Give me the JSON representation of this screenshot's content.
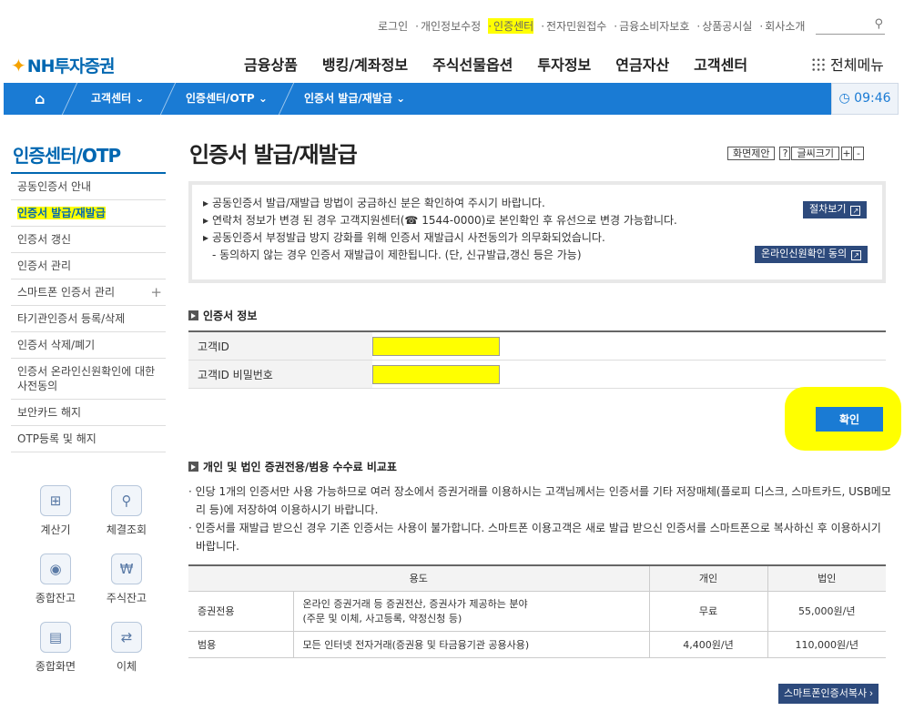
{
  "util_links": [
    "로그인",
    "개인정보수정",
    "인증센터",
    "전자민원접수",
    "금융소비자보호",
    "상품공시실",
    "회사소개"
  ],
  "logo": {
    "text": "NH투자증권"
  },
  "gnb": [
    "금융상품",
    "뱅킹/계좌정보",
    "주식선물옵션",
    "투자정보",
    "연금자산",
    "고객센터"
  ],
  "all_menu": "전체메뉴",
  "breadcrumb": {
    "items": [
      "고객센터",
      "인증센터/OTP",
      "인증서 발급/재발급"
    ],
    "time": "09:46"
  },
  "sidebar": {
    "title": "인증센터/OTP",
    "items": [
      {
        "label": "공동인증서 안내"
      },
      {
        "label": "인증서 발급/재발급"
      },
      {
        "label": "인증서 갱신"
      },
      {
        "label": "인증서 관리"
      },
      {
        "label": "스마트폰 인증서 관리"
      },
      {
        "label": "타기관인증서 등록/삭제"
      },
      {
        "label": "인증서 삭제/폐기"
      },
      {
        "label": "인증서 온라인신원확인에 대한 사전동의"
      },
      {
        "label": "보안카드 해지"
      },
      {
        "label": "OTP등록 및 해지"
      }
    ],
    "quick": [
      {
        "label": "계산기",
        "icon": "calculator-icon"
      },
      {
        "label": "체결조회",
        "icon": "trade-inquiry-icon"
      },
      {
        "label": "종합잔고",
        "icon": "money-bag-icon"
      },
      {
        "label": "주식잔고",
        "icon": "won-coin-icon"
      },
      {
        "label": "종합화면",
        "icon": "chart-screen-icon"
      },
      {
        "label": "이체",
        "icon": "transfer-icon"
      }
    ]
  },
  "page": {
    "title": "인증서 발급/재발급",
    "tools": {
      "suggest": "화면제안",
      "help": "?",
      "font": "글씨크기",
      "plus": "+",
      "minus": "-"
    }
  },
  "info": {
    "lines": [
      "공동인증서 발급/재발급 방법이 궁금하신 분은 확인하여 주시기 바랍니다.",
      "연락처 정보가 변경 된 경우 고객지원센터(☎ 1544-0000)로 본인확인 후 유선으로 변경 가능합니다.",
      "공동인증서 부정발급 방지 강화를 위해 인증서 재발급시 사전동의가 의무화되었습니다.",
      "- 동의하지 않는 경우 인증서 재발급이 제한됩니다. (단, 신규발급,갱신 등은 가능)"
    ],
    "btn_procedure": "절차보기",
    "btn_consent": "온라인신원확인 동의"
  },
  "cert_info": {
    "heading": "인증서 정보",
    "id_label": "고객ID",
    "pw_label": "고객ID 비밀번호",
    "confirm": "확인"
  },
  "fees": {
    "heading": "개인 및 법인 증권전용/범용 수수료 비교표",
    "notes": [
      "· 인당 1개의 인증서만 사용 가능하므로 여러 장소에서 증권거래를 이용하시는 고객님께서는 인증서를 기타 저장매체(플로피 디스크, 스마트카드, USB메모리 등)에 저장하여 이용하시기 바랍니다.",
      "· 인증서를 재발급 받으신 경우 기존 인증서는 사용이 불가합니다. 스마트폰 이용고객은 새로 발급 받으신 인증서를 스마트폰으로 복사하신 후 이용하시기 바랍니다."
    ],
    "headers": [
      "용도",
      "개인",
      "법인"
    ],
    "rows": [
      {
        "type": "증권전용",
        "desc1": "온라인 증권거래 등 증권전산, 증권사가 제공하는 분야",
        "desc2": "(주문 및 이체, 사고등록, 약정신청 등)",
        "personal": "무료",
        "corp": "55,000원/년"
      },
      {
        "type": "범용",
        "desc1": "모든 인터넷 전자거래(증권용 및 타금융기관 공용사용)",
        "desc2": "",
        "personal": "4,400원/년",
        "corp": "110,000원/년"
      }
    ],
    "btn_copy": "스마트폰인증서복사"
  }
}
